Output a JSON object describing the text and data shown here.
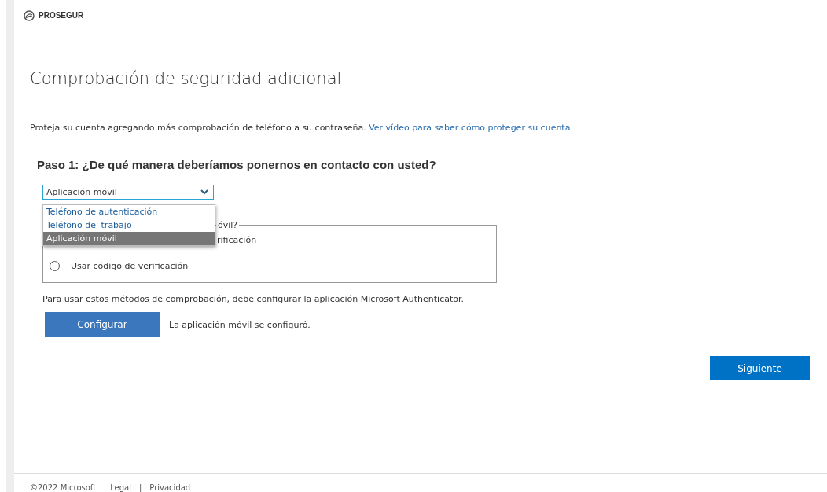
{
  "brand": "PROSEGUR",
  "title": "Comprobación de seguridad adicional",
  "intro": {
    "text": "Proteja su cuenta agregando más comprobación de teléfono a su contraseña.",
    "link": "Ver vídeo para saber cómo proteger su cuenta"
  },
  "step_heading": "Paso 1: ¿De qué manera deberíamos ponernos en contacto con usted?",
  "contact_select": {
    "value": "Aplicación móvil",
    "expanded": true,
    "options": [
      {
        "label": "Teléfono de autenticación",
        "selected": false
      },
      {
        "label": "Teléfono del trabajo",
        "selected": false
      },
      {
        "label": "Aplicación móvil",
        "selected": true
      }
    ]
  },
  "method_group": {
    "legend": "óvil?",
    "options": [
      {
        "label": "rificación"
      },
      {
        "label": "Usar código de verificación",
        "selected": false
      }
    ]
  },
  "note": "Para usar estos métodos de comprobación, debe configurar la aplicación Microsoft Authenticator.",
  "configure_button": "Configurar",
  "configure_status": "La aplicación móvil se configuró.",
  "next_button": "Siguiente",
  "footer": {
    "copyright": "©2022 Microsoft",
    "links": [
      "Legal",
      "Privacidad"
    ],
    "separator": "|"
  }
}
